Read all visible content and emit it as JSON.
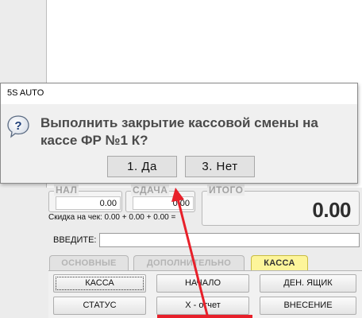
{
  "dialog": {
    "title": "5S AUTO",
    "message": "Выполнить закрытие кассовой смены на кассе ФР №1 К?",
    "yes_label": "1. Да",
    "no_label": "3. Нет",
    "icon": "question-icon"
  },
  "fields": {
    "nal_label": "НАЛ",
    "nal_value": "0.00",
    "sdacha_label": "СДАЧА",
    "sdacha_value": "0.00",
    "itogo_label": "ИТОГО",
    "itogo_value": "0.00"
  },
  "change_line": "Скидка на чек:  0.00 + 0.00 + 0.00 =",
  "input": {
    "label": "ВВЕДИТЕ:",
    "value": ""
  },
  "tabs": [
    {
      "label": "ОСНОВНЫЕ",
      "active": false
    },
    {
      "label": "ДОПОЛНИТЕЛЬНО",
      "active": false
    },
    {
      "label": "КАССА",
      "active": true
    }
  ],
  "buttons": {
    "kassa": "КАССА",
    "nachalo": "НАЧАЛО",
    "den_yashik": "ДЕН. ЯЩИК",
    "status": "СТАТУС",
    "x_otchet": "Х - отчет",
    "vnesenie": "ВНЕСЕНИЕ"
  },
  "colors": {
    "active_tab": "#fdf59a",
    "annotation_arrow": "#e8202a",
    "dialog_text": "#4a4a4a"
  }
}
